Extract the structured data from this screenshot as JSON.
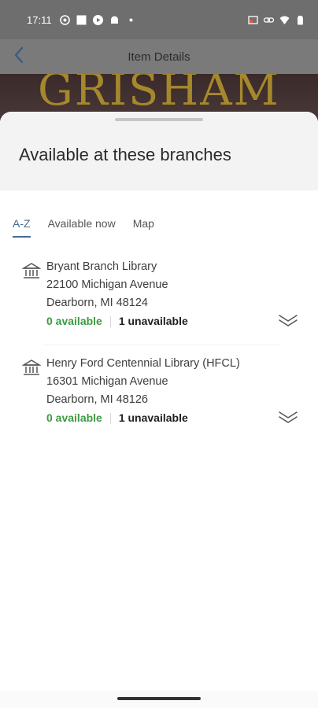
{
  "status_bar": {
    "time": "17:11",
    "left_icons": [
      "whatsapp-icon",
      "square-icon",
      "play-icon",
      "android-icon",
      "dot-icon"
    ],
    "right_icons": [
      "cast-icon",
      "link-icon",
      "wifi-icon",
      "battery-icon"
    ]
  },
  "header": {
    "title": "Item Details",
    "back_icon": "chevron-left-icon"
  },
  "cover": {
    "text": "GRISHAM"
  },
  "sheet": {
    "title": "Available at these branches"
  },
  "tabs": [
    {
      "label": "A-Z",
      "active": true
    },
    {
      "label": "Available now",
      "active": false
    },
    {
      "label": "Map",
      "active": false
    }
  ],
  "branches": [
    {
      "name": "Bryant Branch Library",
      "address1": "22100 Michigan Avenue",
      "address2": "Dearborn, MI 48124",
      "available": "0 available",
      "unavailable": "1 unavailable"
    },
    {
      "name": "Henry Ford Centennial Library (HFCL)",
      "address1": "16301 Michigan Avenue",
      "address2": "Dearborn, MI 48126",
      "available": "0 available",
      "unavailable": "1 unavailable"
    }
  ],
  "colors": {
    "accent": "#4a6a93",
    "available_green": "#3c9a43",
    "status_bar": "#6e6e6e",
    "header": "#7a7a7a"
  }
}
